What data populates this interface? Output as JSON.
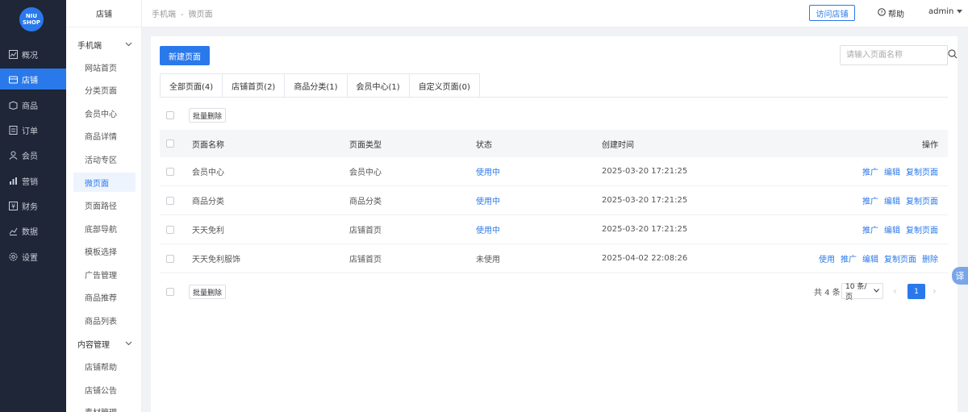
{
  "logo": {
    "line1": "NIU",
    "line2": "SHOP"
  },
  "main_nav": [
    {
      "label": "概况",
      "icon": "chart-icon",
      "active": false
    },
    {
      "label": "店铺",
      "icon": "store-icon",
      "active": true
    },
    {
      "label": "商品",
      "icon": "goods-icon",
      "active": false
    },
    {
      "label": "订单",
      "icon": "order-icon",
      "active": false
    },
    {
      "label": "会员",
      "icon": "member-icon",
      "active": false
    },
    {
      "label": "营销",
      "icon": "marketing-icon",
      "active": false
    },
    {
      "label": "财务",
      "icon": "finance-icon",
      "active": false
    },
    {
      "label": "数据",
      "icon": "data-icon",
      "active": false
    },
    {
      "label": "设置",
      "icon": "settings-icon",
      "active": false
    }
  ],
  "sub_nav": {
    "title": "店铺",
    "group1": "手机端",
    "items": [
      "网站首页",
      "分类页面",
      "会员中心",
      "商品详情",
      "活动专区",
      "微页面",
      "页面路径",
      "底部导航",
      "模板选择",
      "广告管理",
      "商品推荐",
      "商品列表"
    ],
    "group2": "内容管理",
    "items2": [
      "店铺帮助",
      "店铺公告",
      "素材管理"
    ]
  },
  "header": {
    "crumb1": "手机端",
    "crumb_sep": "-",
    "crumb2": "微页面",
    "visit_store": "访问店铺",
    "help": "帮助",
    "user": "admin"
  },
  "toolbar": {
    "new_page": "新建页面",
    "search_placeholder": "请输入页面名称"
  },
  "tabs": [
    "全部页面(4)",
    "店铺首页(2)",
    "商品分类(1)",
    "会员中心(1)",
    "自定义页面(0)"
  ],
  "batch_delete": "批量删除",
  "table": {
    "headers": {
      "name": "页面名称",
      "type": "页面类型",
      "status": "状态",
      "time": "创建时间",
      "ops": "操作"
    },
    "rows": [
      {
        "name": "会员中心",
        "type": "会员中心",
        "status": "使用中",
        "time": "2025-03-20 17:21:25",
        "ops": [
          "推广",
          "编辑",
          "复制页面"
        ]
      },
      {
        "name": "商品分类",
        "type": "商品分类",
        "status": "使用中",
        "time": "2025-03-20 17:21:25",
        "ops": [
          "推广",
          "编辑",
          "复制页面"
        ]
      },
      {
        "name": "天天免利",
        "type": "店铺首页",
        "status": "使用中",
        "time": "2025-03-20 17:21:25",
        "ops": [
          "推广",
          "编辑",
          "复制页面"
        ]
      },
      {
        "name": "天天免利服饰",
        "type": "店铺首页",
        "status": "未使用",
        "time": "2025-04-02 22:08:26",
        "ops": [
          "使用",
          "推广",
          "编辑",
          "复制页面",
          "删除"
        ]
      }
    ]
  },
  "pagination": {
    "total": "共 4 条",
    "page_size": "10 条/页",
    "current": "1"
  },
  "float_translate": "译",
  "colors": {
    "accent": "#2a79ea",
    "sidebar": "#1f2637"
  }
}
